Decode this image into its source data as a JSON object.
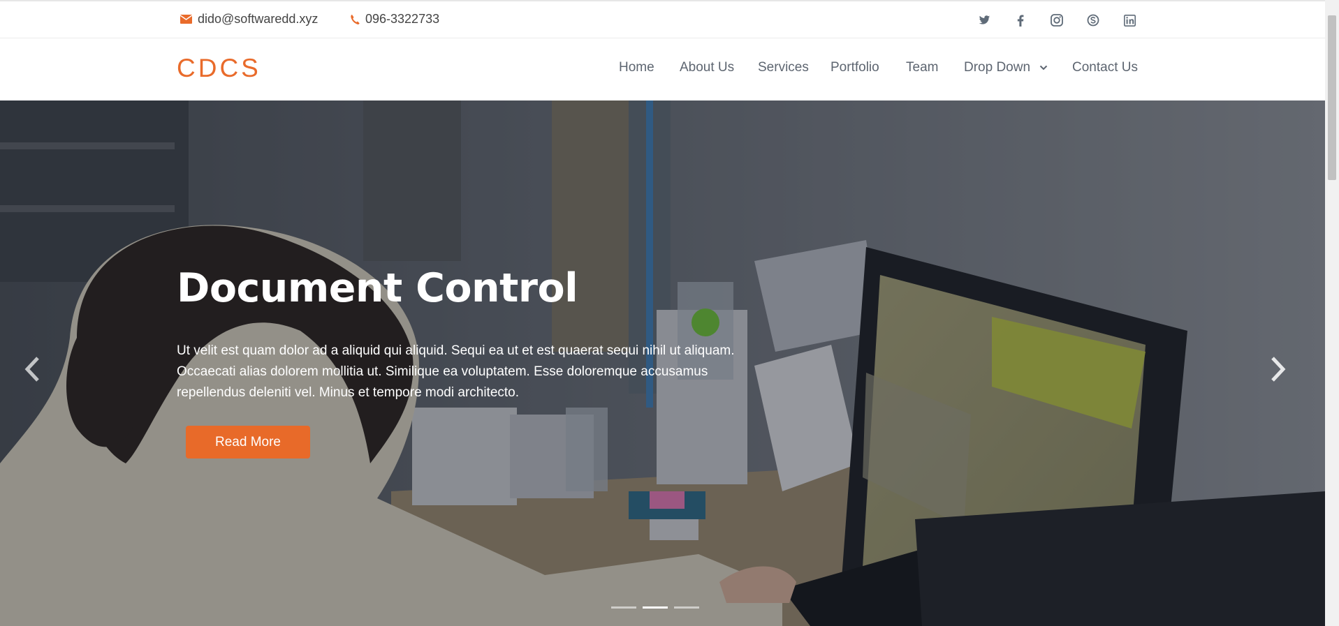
{
  "topbar": {
    "email": "dido@softwaredd.xyz",
    "phone": "096-3322733",
    "email_icon": "envelope-icon",
    "phone_icon": "phone-icon",
    "social": [
      "twitter-icon",
      "facebook-icon",
      "instagram-icon",
      "skype-icon",
      "linkedin-icon"
    ]
  },
  "navbar": {
    "logo": "CDCS",
    "items": [
      "Home",
      "About Us",
      "Services",
      "Portfolio",
      "Team",
      "Drop Down",
      "Contact Us"
    ]
  },
  "hero": {
    "title": "Document Control",
    "text": "Ut velit est quam dolor ad a aliquid qui aliquid. Sequi ea ut et est quaerat sequi nihil ut aliquam. Occaecati alias dolorem mollitia ut. Similique ea voluptatem. Esse doloremque accusamus repellendus deleniti vel. Minus et tempore modi architecto.",
    "button": "Read More",
    "slides_total": 3,
    "active_slide": 2
  },
  "colors": {
    "accent": "#e96b2b",
    "nav_text": "#5d6570",
    "icon_gray": "#5f6b78"
  }
}
